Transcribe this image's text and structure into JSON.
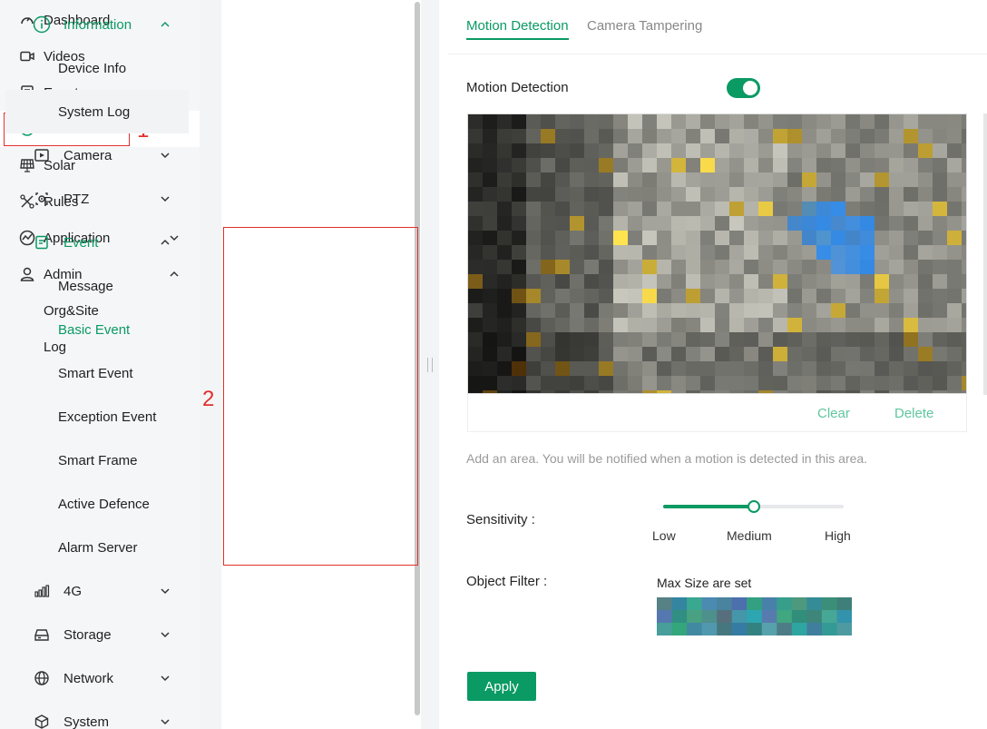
{
  "nav": {
    "items": [
      {
        "label": "Dashboard",
        "icon": "dashboard-icon"
      },
      {
        "label": "Videos",
        "icon": "video-icon"
      },
      {
        "label": "Events",
        "icon": "events-icon"
      },
      {
        "label": "Devices",
        "icon": "devices-icon",
        "active": true
      },
      {
        "label": "Solar",
        "icon": "solar-icon"
      },
      {
        "label": "Rules",
        "icon": "rules-icon"
      },
      {
        "label": "Application",
        "icon": "application-icon",
        "expand": "collapsed"
      },
      {
        "label": "Admin",
        "icon": "admin-icon",
        "expand": "expanded"
      },
      {
        "label": "Org&Site"
      },
      {
        "label": "Log"
      }
    ]
  },
  "annotations": {
    "one": "1",
    "two": "2"
  },
  "menu": {
    "information": "Information",
    "device_info": "Device Info",
    "system_log": "System Log",
    "camera": "Camera",
    "ptz": "PTZ",
    "event": "Event",
    "message": "Message",
    "basic_event": "Basic Event",
    "smart_event": "Smart Event",
    "exception_event": "Exception Event",
    "smart_frame": "Smart Frame",
    "active_defence": "Active Defence",
    "alarm_server": "Alarm Server",
    "g4": "4G",
    "storage": "Storage",
    "network": "Network",
    "system": "System"
  },
  "tabs": {
    "motion": "Motion Detection",
    "tamper": "Camera Tampering"
  },
  "content": {
    "motion_label": "Motion Detection",
    "motion_enabled": true,
    "clear": "Clear",
    "delete": "Delete",
    "hint": "Add an area. You will be notified when a motion is detected in this area.",
    "sensitivity_label": "Sensitivity :",
    "sensitivity_value": 0.5,
    "low": "Low",
    "medium": "Medium",
    "high": "High",
    "object_filter_label": "Object Filter :",
    "object_filter_value": "Max Size are set",
    "apply": "Apply"
  },
  "colors": {
    "accent": "#0a9a63",
    "annotation": "#e0302d",
    "motion_area": "#2e8cf0"
  }
}
